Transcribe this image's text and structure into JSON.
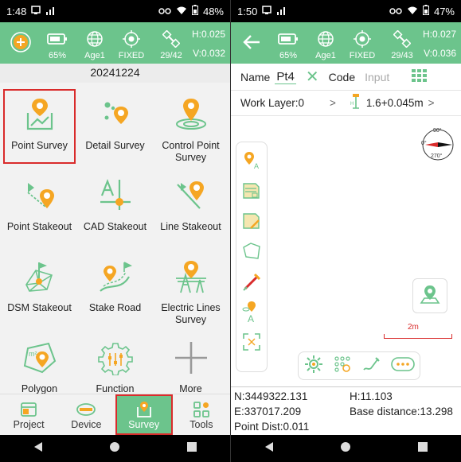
{
  "left": {
    "status": {
      "time": "1:48",
      "battery": "48%"
    },
    "gnss": {
      "battery_pct": "65%",
      "age": "Age1",
      "fix": "FIXED",
      "sats": "29/42",
      "h": "H:0.025",
      "v": "V:0.032"
    },
    "date": "20241224",
    "grid": [
      {
        "label": "Point Survey",
        "icon": "point-survey-icon"
      },
      {
        "label": "Detail Survey",
        "icon": "detail-survey-icon"
      },
      {
        "label": "Control Point Survey",
        "icon": "control-point-icon"
      },
      {
        "label": "Point Stakeout",
        "icon": "point-stakeout-icon"
      },
      {
        "label": "CAD Stakeout",
        "icon": "cad-stakeout-icon"
      },
      {
        "label": "Line Stakeout",
        "icon": "line-stakeout-icon"
      },
      {
        "label": "DSM Stakeout",
        "icon": "dsm-stakeout-icon"
      },
      {
        "label": "Stake Road",
        "icon": "stake-road-icon"
      },
      {
        "label": "Electric Lines Survey",
        "icon": "electric-lines-icon"
      },
      {
        "label": "Polygon",
        "icon": "polygon-icon"
      },
      {
        "label": "Function",
        "icon": "function-icon"
      },
      {
        "label": "More",
        "icon": "plus-icon"
      }
    ],
    "tabs": [
      {
        "label": "Project"
      },
      {
        "label": "Device"
      },
      {
        "label": "Survey"
      },
      {
        "label": "Tools"
      }
    ]
  },
  "right": {
    "status": {
      "time": "1:50",
      "battery": "47%"
    },
    "gnss": {
      "battery_pct": "65%",
      "age": "Age1",
      "fix": "FIXED",
      "sats": "29/43",
      "h": "H:0.027",
      "v": "V:0.036"
    },
    "name_label": "Name",
    "name_value": "Pt4",
    "code_label": "Code",
    "code_placeholder": "Input",
    "layer": "Work Layer:0",
    "layer_chev": ">",
    "height": "1.6+0.045m",
    "height_chev": ">",
    "compass_90": "90°",
    "compass_0": "0°",
    "compass_270": "270°",
    "scale": "2m",
    "north": "N:3449322.131",
    "east": "E:337017.209",
    "hval": "H:11.103",
    "base_distance": "Base distance:13.298",
    "point_dist": "Point Dist:0.011"
  },
  "colors": {
    "accent": "#6cc48c",
    "highlight": "#d92b2b",
    "pin": "#f5a623"
  }
}
